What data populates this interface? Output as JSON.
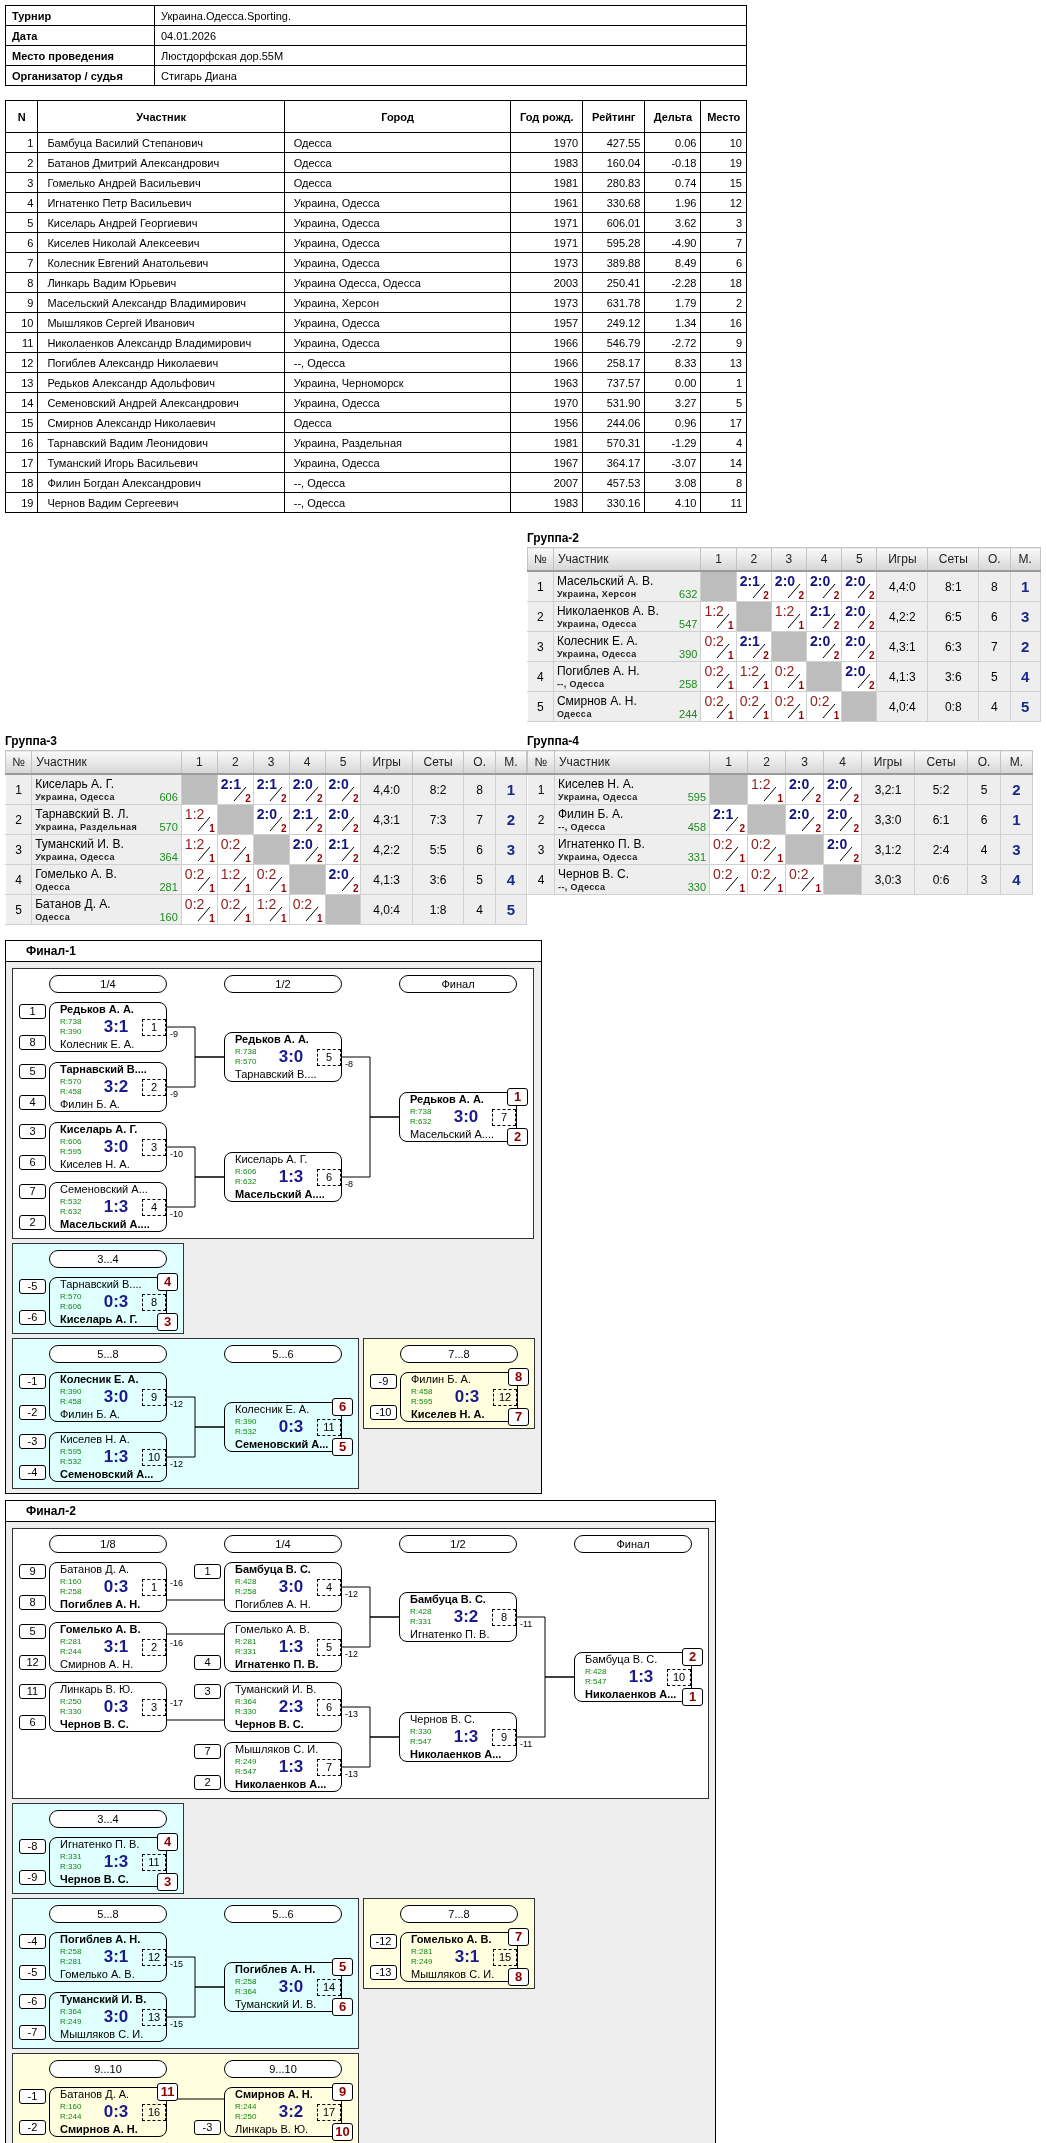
{
  "info": [
    {
      "label": "Турнир",
      "value": "Украина.Одесса.Sporting."
    },
    {
      "label": "Дата",
      "value": "04.01.2026"
    },
    {
      "label": "Место проведения",
      "value": "Люстдорфская дор.55М"
    },
    {
      "label": "Организатор / судья",
      "value": "Стигарь Диана"
    }
  ],
  "participants": {
    "columns": [
      "N",
      "Участник",
      "Город",
      "Год рожд.",
      "Рейтинг",
      "Дельта",
      "Место"
    ],
    "rows": [
      [
        "1",
        "Бамбуца Василий Степанович",
        "Одесса",
        "1970",
        "427.55",
        "0.06",
        "10"
      ],
      [
        "2",
        "Батанов Дмитрий Александрович",
        "Одесса",
        "1983",
        "160.04",
        "-0.18",
        "19"
      ],
      [
        "3",
        "Гомелько Андрей Васильевич",
        "Одесса",
        "1981",
        "280.83",
        "0.74",
        "15"
      ],
      [
        "4",
        "Игнатенко Петр Васильевич",
        "Украина, Одесса",
        "1961",
        "330.68",
        "1.96",
        "12"
      ],
      [
        "5",
        "Киселарь Андрей Георгиевич",
        "Украина, Одесса",
        "1971",
        "606.01",
        "3.62",
        "3"
      ],
      [
        "6",
        "Киселев Николай Алексеевич",
        "Украина, Одесса",
        "1971",
        "595.28",
        "-4.90",
        "7"
      ],
      [
        "7",
        "Колесник Евгений Анатольевич",
        "Украина, Одесса",
        "1973",
        "389.88",
        "8.49",
        "6"
      ],
      [
        "8",
        "Линкарь Вадим Юрьевич",
        "Украина Одесса, Одесса",
        "2003",
        "250.41",
        "-2.28",
        "18"
      ],
      [
        "9",
        "Масельский Александр Владимирович",
        "Украина, Херсон",
        "1973",
        "631.78",
        "1.79",
        "2"
      ],
      [
        "10",
        "Мышляков Сергей Иванович",
        "Украина, Одесса",
        "1957",
        "249.12",
        "1.34",
        "16"
      ],
      [
        "11",
        "Николаенков Александр Владимирович",
        "Украина, Одесса",
        "1966",
        "546.79",
        "-2.72",
        "9"
      ],
      [
        "12",
        "Погиблев Александр Николаевич",
        "--, Одесса",
        "1966",
        "258.17",
        "8.33",
        "13"
      ],
      [
        "13",
        "Редьков Александр Адольфович",
        "Украина, Черноморск",
        "1963",
        "737.57",
        "0.00",
        "1"
      ],
      [
        "14",
        "Семеновский Андрей Александрович",
        "Украина, Одесса",
        "1970",
        "531.90",
        "3.27",
        "5"
      ],
      [
        "15",
        "Смирнов Александр Николаевич",
        "Одесса",
        "1956",
        "244.06",
        "0.96",
        "17"
      ],
      [
        "16",
        "Тарнавский Вадим Леонидович",
        "Украина, Раздельная",
        "1981",
        "570.31",
        "-1.29",
        "4"
      ],
      [
        "17",
        "Туманский Игорь Васильевич",
        "Украина, Одесса",
        "1967",
        "364.17",
        "-3.07",
        "14"
      ],
      [
        "18",
        "Филин Богдан Александрович",
        "--, Одесса",
        "2007",
        "457.53",
        "3.08",
        "8"
      ],
      [
        "19",
        "Чернов Вадим Сергеевич",
        "--, Одесса",
        "1983",
        "330.16",
        "4.10",
        "11"
      ]
    ]
  },
  "groups": [
    {
      "title": "Группа-2",
      "columns": [
        "№",
        "Участник",
        "1",
        "2",
        "3",
        "4",
        "5",
        "Игры",
        "Сеты",
        "О.",
        "М."
      ],
      "rows": [
        {
          "n": "1",
          "name": "Масельский А. В.",
          "city": "Украина, Херсон",
          "rating": "632",
          "results": [
            {
              "kind": "self"
            },
            {
              "kind": "win",
              "score": "2:1",
              "points": "2"
            },
            {
              "kind": "win",
              "score": "2:0",
              "points": "2"
            },
            {
              "kind": "win",
              "score": "2:0",
              "points": "2"
            },
            {
              "kind": "win",
              "score": "2:0",
              "points": "2"
            }
          ],
          "games": "4,4:0",
          "sets": "8:1",
          "points": "8",
          "place": "1"
        },
        {
          "n": "2",
          "name": "Николаенков А. В.",
          "city": "Украина, Одесса",
          "rating": "547",
          "results": [
            {
              "kind": "loss",
              "score": "1:2",
              "points": "1"
            },
            {
              "kind": "self"
            },
            {
              "kind": "loss",
              "score": "1:2",
              "points": "1"
            },
            {
              "kind": "win",
              "score": "2:1",
              "points": "2"
            },
            {
              "kind": "win",
              "score": "2:0",
              "points": "2"
            }
          ],
          "games": "4,2:2",
          "sets": "6:5",
          "points": "6",
          "place": "3"
        },
        {
          "n": "3",
          "name": "Колесник Е. А.",
          "city": "Украина, Одесса",
          "rating": "390",
          "results": [
            {
              "kind": "loss",
              "score": "0:2",
              "points": "1"
            },
            {
              "kind": "win",
              "score": "2:1",
              "points": "2"
            },
            {
              "kind": "self"
            },
            {
              "kind": "win",
              "score": "2:0",
              "points": "2"
            },
            {
              "kind": "win",
              "score": "2:0",
              "points": "2"
            }
          ],
          "games": "4,3:1",
          "sets": "6:3",
          "points": "7",
          "place": "2"
        },
        {
          "n": "4",
          "name": "Погиблев А. Н.",
          "city": "--, Одесса",
          "rating": "258",
          "results": [
            {
              "kind": "loss",
              "score": "0:2",
              "points": "1"
            },
            {
              "kind": "loss",
              "score": "1:2",
              "points": "1"
            },
            {
              "kind": "loss",
              "score": "0:2",
              "points": "1"
            },
            {
              "kind": "self"
            },
            {
              "kind": "win",
              "score": "2:0",
              "points": "2"
            }
          ],
          "games": "4,1:3",
          "sets": "3:6",
          "points": "5",
          "place": "4"
        },
        {
          "n": "5",
          "name": "Смирнов А. Н.",
          "city": "Одесса",
          "rating": "244",
          "results": [
            {
              "kind": "loss",
              "score": "0:2",
              "points": "1"
            },
            {
              "kind": "loss",
              "score": "0:2",
              "points": "1"
            },
            {
              "kind": "loss",
              "score": "0:2",
              "points": "1"
            },
            {
              "kind": "loss",
              "score": "0:2",
              "points": "1"
            },
            {
              "kind": "self"
            }
          ],
          "games": "4,0:4",
          "sets": "0:8",
          "points": "4",
          "place": "5"
        }
      ]
    },
    {
      "title": "Группа-3",
      "columns": [
        "№",
        "Участник",
        "1",
        "2",
        "3",
        "4",
        "5",
        "Игры",
        "Сеты",
        "О.",
        "М."
      ],
      "rows": [
        {
          "n": "1",
          "name": "Киселарь А. Г.",
          "city": "Украина, Одесса",
          "rating": "606",
          "results": [
            {
              "kind": "self"
            },
            {
              "kind": "win",
              "score": "2:1",
              "points": "2"
            },
            {
              "kind": "win",
              "score": "2:1",
              "points": "2"
            },
            {
              "kind": "win",
              "score": "2:0",
              "points": "2"
            },
            {
              "kind": "win",
              "score": "2:0",
              "points": "2"
            }
          ],
          "games": "4,4:0",
          "sets": "8:2",
          "points": "8",
          "place": "1"
        },
        {
          "n": "2",
          "name": "Тарнавский В. Л.",
          "city": "Украина, Раздельная",
          "rating": "570",
          "results": [
            {
              "kind": "loss",
              "score": "1:2",
              "points": "1"
            },
            {
              "kind": "self"
            },
            {
              "kind": "win",
              "score": "2:0",
              "points": "2"
            },
            {
              "kind": "win",
              "score": "2:1",
              "points": "2"
            },
            {
              "kind": "win",
              "score": "2:0",
              "points": "2"
            }
          ],
          "games": "4,3:1",
          "sets": "7:3",
          "points": "7",
          "place": "2"
        },
        {
          "n": "3",
          "name": "Туманский И. В.",
          "city": "Украина, Одесса",
          "rating": "364",
          "results": [
            {
              "kind": "loss",
              "score": "1:2",
              "points": "1"
            },
            {
              "kind": "loss",
              "score": "0:2",
              "points": "1"
            },
            {
              "kind": "self"
            },
            {
              "kind": "win",
              "score": "2:0",
              "points": "2"
            },
            {
              "kind": "win",
              "score": "2:1",
              "points": "2"
            }
          ],
          "games": "4,2:2",
          "sets": "5:5",
          "points": "6",
          "place": "3"
        },
        {
          "n": "4",
          "name": "Гомелько А. В.",
          "city": "Одесса",
          "rating": "281",
          "results": [
            {
              "kind": "loss",
              "score": "0:2",
              "points": "1"
            },
            {
              "kind": "loss",
              "score": "1:2",
              "points": "1"
            },
            {
              "kind": "loss",
              "score": "0:2",
              "points": "1"
            },
            {
              "kind": "self"
            },
            {
              "kind": "win",
              "score": "2:0",
              "points": "2"
            }
          ],
          "games": "4,1:3",
          "sets": "3:6",
          "points": "5",
          "place": "4"
        },
        {
          "n": "5",
          "name": "Батанов Д. А.",
          "city": "Одесса",
          "rating": "160",
          "results": [
            {
              "kind": "loss",
              "score": "0:2",
              "points": "1"
            },
            {
              "kind": "loss",
              "score": "0:2",
              "points": "1"
            },
            {
              "kind": "loss",
              "score": "1:2",
              "points": "1"
            },
            {
              "kind": "loss",
              "score": "0:2",
              "points": "1"
            },
            {
              "kind": "self"
            }
          ],
          "games": "4,0:4",
          "sets": "1:8",
          "points": "4",
          "place": "5"
        }
      ]
    },
    {
      "title": "Группа-4",
      "columns": [
        "№",
        "Участник",
        "1",
        "2",
        "3",
        "4",
        "Игры",
        "Сеты",
        "О.",
        "М."
      ],
      "rows": [
        {
          "n": "1",
          "name": "Киселев Н. А.",
          "city": "Украина, Одесса",
          "rating": "595",
          "results": [
            {
              "kind": "self"
            },
            {
              "kind": "loss",
              "score": "1:2",
              "points": "1"
            },
            {
              "kind": "win",
              "score": "2:0",
              "points": "2"
            },
            {
              "kind": "win",
              "score": "2:0",
              "points": "2"
            }
          ],
          "games": "3,2:1",
          "sets": "5:2",
          "points": "5",
          "place": "2"
        },
        {
          "n": "2",
          "name": "Филин Б. А.",
          "city": "--, Одесса",
          "rating": "458",
          "results": [
            {
              "kind": "win",
              "score": "2:1",
              "points": "2"
            },
            {
              "kind": "self"
            },
            {
              "kind": "win",
              "score": "2:0",
              "points": "2"
            },
            {
              "kind": "win",
              "score": "2:0",
              "points": "2"
            }
          ],
          "games": "3,3:0",
          "sets": "6:1",
          "points": "6",
          "place": "1"
        },
        {
          "n": "3",
          "name": "Игнатенко П. В.",
          "city": "Украина, Одесса",
          "rating": "331",
          "results": [
            {
              "kind": "loss",
              "score": "0:2",
              "points": "1"
            },
            {
              "kind": "loss",
              "score": "0:2",
              "points": "1"
            },
            {
              "kind": "self"
            },
            {
              "kind": "win",
              "score": "2:0",
              "points": "2"
            }
          ],
          "games": "3,1:2",
          "sets": "2:4",
          "points": "4",
          "place": "3"
        },
        {
          "n": "4",
          "name": "Чернов В. С.",
          "city": "--, Одесса",
          "rating": "330",
          "results": [
            {
              "kind": "loss",
              "score": "0:2",
              "points": "1"
            },
            {
              "kind": "loss",
              "score": "0:2",
              "points": "1"
            },
            {
              "kind": "loss",
              "score": "0:2",
              "points": "1"
            },
            {
              "kind": "self"
            }
          ],
          "games": "3,0:3",
          "sets": "0:6",
          "points": "3",
          "place": "4"
        }
      ]
    }
  ],
  "finals": [
    {
      "title": "Финал-1",
      "rows": [
        {
          "sections": [
            {
              "color": "#ffffff",
              "columns": [
                {
                  "label": "1/4",
                  "matches": [
                    {
                      "number": "1",
                      "score": "3:1",
                      "loser_to": "-9",
                      "players": [
                        {
                          "seed": "1",
                          "name": "Редьков А. А.",
                          "rating": "R:738",
                          "winner": true
                        },
                        {
                          "seed": "8",
                          "name": "Колесник Е. А.",
                          "rating": "R:390",
                          "winner": false
                        }
                      ]
                    },
                    {
                      "number": "2",
                      "score": "3:2",
                      "loser_to": "-9",
                      "players": [
                        {
                          "seed": "5",
                          "name": "Тарнавский В....",
                          "rating": "R:570",
                          "winner": true
                        },
                        {
                          "seed": "4",
                          "name": "Филин Б. А.",
                          "rating": "R:458",
                          "winner": false
                        }
                      ]
                    },
                    {
                      "number": "3",
                      "score": "3:0",
                      "loser_to": "-10",
                      "players": [
                        {
                          "seed": "3",
                          "name": "Киселарь А. Г.",
                          "rating": "R:606",
                          "winner": true
                        },
                        {
                          "seed": "6",
                          "name": "Киселев Н. А.",
                          "rating": "R:595",
                          "winner": false
                        }
                      ]
                    },
                    {
                      "number": "4",
                      "score": "1:3",
                      "loser_to": "-10",
                      "players": [
                        {
                          "seed": "7",
                          "name": "Семеновский А...",
                          "rating": "R:532",
                          "winner": false
                        },
                        {
                          "seed": "2",
                          "name": "Масельский А....",
                          "rating": "R:632",
                          "winner": true
                        }
                      ]
                    }
                  ]
                },
                {
                  "label": "1/2",
                  "matches": [
                    {
                      "number": "5",
                      "score": "3:0",
                      "loser_to": "-8",
                      "players": [
                        {
                          "name": "Редьков А. А.",
                          "rating": "R:738",
                          "winner": true
                        },
                        {
                          "name": "Тарнавский В....",
                          "rating": "R:570",
                          "winner": false
                        }
                      ]
                    },
                    {
                      "number": "6",
                      "score": "1:3",
                      "loser_to": "-8",
                      "players": [
                        {
                          "name": "Киселарь А. Г.",
                          "rating": "R:606",
                          "winner": false
                        },
                        {
                          "name": "Масельский А....",
                          "rating": "R:632",
                          "winner": true
                        }
                      ]
                    }
                  ]
                },
                {
                  "label": "Финал",
                  "matches": [
                    {
                      "number": "7",
                      "score": "3:0",
                      "players": [
                        {
                          "name": "Редьков А. А.",
                          "rating": "R:738",
                          "winner": true,
                          "place": "1"
                        },
                        {
                          "name": "Масельский А....",
                          "rating": "R:632",
                          "winner": false,
                          "place": "2"
                        }
                      ]
                    }
                  ]
                }
              ]
            }
          ]
        },
        {
          "sections": [
            {
              "color": "#e0ffff",
              "columns": [
                {
                  "label": "3...4",
                  "matches": [
                    {
                      "number": "8",
                      "score": "0:3",
                      "players": [
                        {
                          "seed": "-5",
                          "name": "Тарнавский В....",
                          "rating": "R:570",
                          "winner": false,
                          "place": "4"
                        },
                        {
                          "seed": "-6",
                          "name": "Киселарь А. Г.",
                          "rating": "R:606",
                          "winner": true,
                          "place": "3"
                        }
                      ]
                    }
                  ]
                }
              ]
            }
          ]
        },
        {
          "sections": [
            {
              "color": "#e0ffff",
              "columns": [
                {
                  "label": "5...8",
                  "matches": [
                    {
                      "number": "9",
                      "score": "3:0",
                      "loser_to": "-12",
                      "players": [
                        {
                          "seed": "-1",
                          "name": "Колесник Е. А.",
                          "rating": "R:390",
                          "winner": true
                        },
                        {
                          "seed": "-2",
                          "name": "Филин Б. А.",
                          "rating": "R:458",
                          "winner": false
                        }
                      ]
                    },
                    {
                      "number": "10",
                      "score": "1:3",
                      "loser_to": "-12",
                      "players": [
                        {
                          "seed": "-3",
                          "name": "Киселев Н. А.",
                          "rating": "R:595",
                          "winner": false
                        },
                        {
                          "seed": "-4",
                          "name": "Семеновский А...",
                          "rating": "R:532",
                          "winner": true
                        }
                      ]
                    }
                  ]
                },
                {
                  "label": "5...6",
                  "matches": [
                    {
                      "number": "11",
                      "score": "0:3",
                      "players": [
                        {
                          "name": "Колесник Е. А.",
                          "rating": "R:390",
                          "winner": false,
                          "place": "6"
                        },
                        {
                          "name": "Семеновский А...",
                          "rating": "R:532",
                          "winner": true,
                          "place": "5"
                        }
                      ]
                    }
                  ]
                }
              ]
            },
            {
              "color": "#ffffe0",
              "columns": [
                {
                  "label": "7...8",
                  "matches": [
                    {
                      "number": "12",
                      "score": "0:3",
                      "players": [
                        {
                          "seed": "-9",
                          "name": "Филин Б. А.",
                          "rating": "R:458",
                          "winner": false,
                          "place": "8"
                        },
                        {
                          "seed": "-10",
                          "name": "Киселев Н. А.",
                          "rating": "R:595",
                          "winner": true,
                          "place": "7"
                        }
                      ]
                    }
                  ]
                }
              ]
            }
          ]
        }
      ]
    },
    {
      "title": "Финал-2",
      "rows": [
        {
          "sections": [
            {
              "color": "#ffffff",
              "columns": [
                {
                  "label": "1/8",
                  "matches": [
                    {
                      "number": "1",
                      "score": "0:3",
                      "loser_to": "-16",
                      "players": [
                        {
                          "seed": "9",
                          "name": "Батанов Д. А.",
                          "rating": "R:160",
                          "winner": false
                        },
                        {
                          "seed": "8",
                          "name": "Погиблев А. Н.",
                          "rating": "R:258",
                          "winner": true
                        }
                      ]
                    },
                    {
                      "number": "2",
                      "score": "3:1",
                      "loser_to": "-16",
                      "players": [
                        {
                          "seed": "5",
                          "name": "Гомелько А. В.",
                          "rating": "R:281",
                          "winner": true
                        },
                        {
                          "seed": "12",
                          "name": "Смирнов А. Н.",
                          "rating": "R:244",
                          "winner": false
                        }
                      ]
                    },
                    {
                      "number": "3",
                      "score": "0:3",
                      "loser_to": "-17",
                      "players": [
                        {
                          "seed": "11",
                          "name": "Линкарь В. Ю.",
                          "rating": "R:250",
                          "winner": false
                        },
                        {
                          "seed": "6",
                          "name": "Чернов В. С.",
                          "rating": "R:330",
                          "winner": true
                        }
                      ]
                    }
                  ]
                },
                {
                  "label": "1/4",
                  "matches": [
                    {
                      "number": "4",
                      "score": "3:0",
                      "loser_to": "-12",
                      "players": [
                        {
                          "seed": "1",
                          "name": "Бамбуца В. С.",
                          "rating": "R:428",
                          "winner": true
                        },
                        {
                          "name": "Погиблев А. Н.",
                          "rating": "R:258",
                          "winner": false
                        }
                      ]
                    },
                    {
                      "number": "5",
                      "score": "1:3",
                      "loser_to": "-12",
                      "players": [
                        {
                          "name": "Гомелько А. В.",
                          "rating": "R:281",
                          "winner": false
                        },
                        {
                          "seed": "4",
                          "name": "Игнатенко П. В.",
                          "rating": "R:331",
                          "winner": true
                        }
                      ]
                    },
                    {
                      "number": "6",
                      "score": "2:3",
                      "loser_to": "-13",
                      "players": [
                        {
                          "seed": "3",
                          "name": "Туманский И. В.",
                          "rating": "R:364",
                          "winner": false
                        },
                        {
                          "name": "Чернов В. С.",
                          "rating": "R:330",
                          "winner": true
                        }
                      ]
                    },
                    {
                      "number": "7",
                      "score": "1:3",
                      "loser_to": "-13",
                      "players": [
                        {
                          "seed": "7",
                          "name": "Мышляков С. И.",
                          "rating": "R:249",
                          "winner": false
                        },
                        {
                          "seed": "2",
                          "name": "Николаенков А...",
                          "rating": "R:547",
                          "winner": true
                        }
                      ]
                    }
                  ]
                },
                {
                  "label": "1/2",
                  "matches": [
                    {
                      "number": "8",
                      "score": "3:2",
                      "loser_to": "-11",
                      "players": [
                        {
                          "name": "Бамбуца В. С.",
                          "rating": "R:428",
                          "winner": true
                        },
                        {
                          "name": "Игнатенко П. В.",
                          "rating": "R:331",
                          "winner": false
                        }
                      ]
                    },
                    {
                      "number": "9",
                      "score": "1:3",
                      "loser_to": "-11",
                      "players": [
                        {
                          "name": "Чернов В. С.",
                          "rating": "R:330",
                          "winner": false
                        },
                        {
                          "name": "Николаенков А...",
                          "rating": "R:547",
                          "winner": true
                        }
                      ]
                    }
                  ]
                },
                {
                  "label": "Финал",
                  "matches": [
                    {
                      "number": "10",
                      "score": "1:3",
                      "players": [
                        {
                          "name": "Бамбуца В. С.",
                          "rating": "R:428",
                          "winner": false,
                          "place": "2"
                        },
                        {
                          "name": "Николаенков А...",
                          "rating": "R:547",
                          "winner": true,
                          "place": "1"
                        }
                      ]
                    }
                  ]
                }
              ]
            }
          ]
        },
        {
          "sections": [
            {
              "color": "#e0ffff",
              "columns": [
                {
                  "label": "3...4",
                  "matches": [
                    {
                      "number": "11",
                      "score": "1:3",
                      "players": [
                        {
                          "seed": "-8",
                          "name": "Игнатенко П. В.",
                          "rating": "R:331",
                          "winner": false,
                          "place": "4"
                        },
                        {
                          "seed": "-9",
                          "name": "Чернов В. С.",
                          "rating": "R:330",
                          "winner": true,
                          "place": "3"
                        }
                      ]
                    }
                  ]
                }
              ]
            }
          ]
        },
        {
          "sections": [
            {
              "color": "#e0ffff",
              "columns": [
                {
                  "label": "5...8",
                  "matches": [
                    {
                      "number": "12",
                      "score": "3:1",
                      "loser_to": "-15",
                      "players": [
                        {
                          "seed": "-4",
                          "name": "Погиблев А. Н.",
                          "rating": "R:258",
                          "winner": true
                        },
                        {
                          "seed": "-5",
                          "name": "Гомелько А. В.",
                          "rating": "R:281",
                          "winner": false
                        }
                      ]
                    },
                    {
                      "number": "13",
                      "score": "3:0",
                      "loser_to": "-15",
                      "players": [
                        {
                          "seed": "-6",
                          "name": "Туманский И. В.",
                          "rating": "R:364",
                          "winner": true
                        },
                        {
                          "seed": "-7",
                          "name": "Мышляков С. И.",
                          "rating": "R:249",
                          "winner": false
                        }
                      ]
                    }
                  ]
                },
                {
                  "label": "5...6",
                  "matches": [
                    {
                      "number": "14",
                      "score": "3:0",
                      "players": [
                        {
                          "name": "Погиблев А. Н.",
                          "rating": "R:258",
                          "winner": true,
                          "place": "5"
                        },
                        {
                          "name": "Туманский И. В.",
                          "rating": "R:364",
                          "winner": false,
                          "place": "6"
                        }
                      ]
                    }
                  ]
                }
              ]
            },
            {
              "color": "#ffffe0",
              "columns": [
                {
                  "label": "7...8",
                  "matches": [
                    {
                      "number": "15",
                      "score": "3:1",
                      "players": [
                        {
                          "seed": "-12",
                          "name": "Гомелько А. В.",
                          "rating": "R:281",
                          "winner": true,
                          "place": "7"
                        },
                        {
                          "seed": "-13",
                          "name": "Мышляков С. И.",
                          "rating": "R:249",
                          "winner": false,
                          "place": "8"
                        }
                      ]
                    }
                  ]
                }
              ]
            }
          ]
        },
        {
          "sections": [
            {
              "color": "#ffffe0",
              "columns": [
                {
                  "label": "9...10",
                  "matches": [
                    {
                      "number": "16",
                      "score": "0:3",
                      "players": [
                        {
                          "seed": "-1",
                          "name": "Батанов Д. А.",
                          "rating": "R:160",
                          "winner": false,
                          "place": "11"
                        },
                        {
                          "seed": "-2",
                          "name": "Смирнов А. Н.",
                          "rating": "R:244",
                          "winner": true
                        }
                      ]
                    }
                  ]
                },
                {
                  "label": "9...10",
                  "matches": [
                    {
                      "number": "17",
                      "score": "3:2",
                      "players": [
                        {
                          "name": "Смирнов А. Н.",
                          "rating": "R:244",
                          "winner": true,
                          "place": "9"
                        },
                        {
                          "seed": "-3",
                          "name": "Линкарь В. Ю.",
                          "rating": "R:250",
                          "winner": false,
                          "place": "10"
                        }
                      ]
                    }
                  ]
                }
              ]
            }
          ]
        }
      ]
    }
  ]
}
